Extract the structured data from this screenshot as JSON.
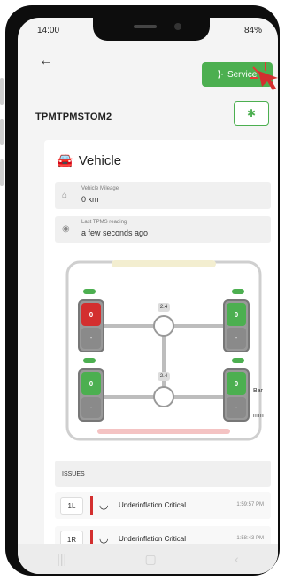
{
  "status": {
    "time": "14:00",
    "battery": "84%"
  },
  "topbar": {
    "back_icon": "back-arrow-icon",
    "service_label": "Service",
    "service_icon": "signal-icon"
  },
  "device": {
    "id": "TPMTPMSTOM2",
    "bt_icon": "bluetooth-icon"
  },
  "vehicle": {
    "title": "Vehicle",
    "mileage": {
      "label": "Vehicle Mileage",
      "value": "0 km"
    },
    "tpms": {
      "label": "Last TPMS reading",
      "value": "a few seconds ago"
    }
  },
  "diagram": {
    "axle_pressures": [
      "2.4",
      "2.4"
    ],
    "units": {
      "pressure": "Bar",
      "tread": "mm"
    },
    "tires": [
      {
        "pos": "front-left",
        "value": "0",
        "status": "critical",
        "tread": "-"
      },
      {
        "pos": "front-right",
        "value": "0",
        "status": "ok",
        "tread": "-"
      },
      {
        "pos": "rear-left",
        "value": "0",
        "status": "ok",
        "tread": "-"
      },
      {
        "pos": "rear-right",
        "value": "0",
        "status": "ok",
        "tread": "-"
      }
    ],
    "colors": {
      "critical": "#d32f2f",
      "ok": "#4caf50"
    }
  },
  "issues": {
    "header": "ISSUES",
    "items": [
      {
        "pos": "1L",
        "text": "Underinflation Critical",
        "time": "1:59:57 PM"
      },
      {
        "pos": "1R",
        "text": "Underinflation Critical",
        "time": "1:58:43 PM"
      }
    ]
  }
}
